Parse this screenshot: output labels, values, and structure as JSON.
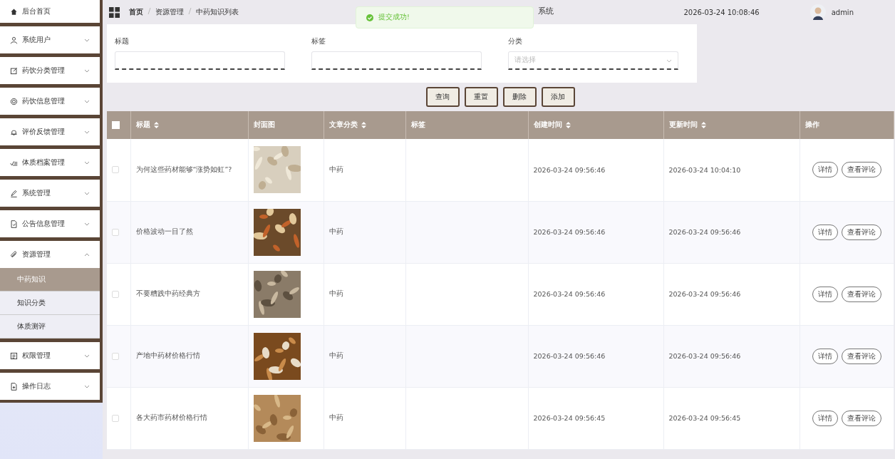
{
  "sidebar": {
    "items": [
      {
        "label": "后台首页",
        "kind": "link"
      },
      {
        "label": "系统用户",
        "kind": "group",
        "expanded": false
      },
      {
        "label": "药饮分类管理",
        "kind": "group",
        "expanded": false
      },
      {
        "label": "药饮信息管理",
        "kind": "group",
        "expanded": false
      },
      {
        "label": "评价反馈管理",
        "kind": "group",
        "expanded": false
      },
      {
        "label": "体质档案管理",
        "kind": "group",
        "expanded": false
      },
      {
        "label": "系统管理",
        "kind": "group",
        "expanded": false
      },
      {
        "label": "公告信息管理",
        "kind": "group",
        "expanded": false
      },
      {
        "label": "资源管理",
        "kind": "group",
        "expanded": true,
        "children": [
          {
            "label": "中药知识",
            "selected": true
          },
          {
            "label": "知识分类",
            "selected": false
          },
          {
            "label": "体质测评",
            "selected": false
          }
        ]
      },
      {
        "label": "权限管理",
        "kind": "group",
        "expanded": false
      },
      {
        "label": "操作日志",
        "kind": "group",
        "expanded": false
      }
    ]
  },
  "header": {
    "breadcrumb": [
      "首页",
      "资源管理",
      "中药知识列表"
    ],
    "title": "系统",
    "datetime": "2026-03-24 10:08:46",
    "user": "admin"
  },
  "toast": {
    "message": "提交成功!"
  },
  "filters": [
    {
      "label": "标题",
      "kind": "text"
    },
    {
      "label": "标签",
      "kind": "text"
    },
    {
      "label": "分类",
      "kind": "select",
      "placeholder": "请选择"
    }
  ],
  "buttons": [
    "查询",
    "重置",
    "删除",
    "添加"
  ],
  "table": {
    "select_all": {
      "checked": false
    },
    "columns": [
      {
        "label": "标题",
        "sortable": true
      },
      {
        "label": "封面图",
        "sortable": false
      },
      {
        "label": "文章分类",
        "sortable": true
      },
      {
        "label": "标签",
        "sortable": false
      },
      {
        "label": "创建时间",
        "sortable": true
      },
      {
        "label": "更新时间",
        "sortable": true
      },
      {
        "label": "操作",
        "sortable": false
      }
    ],
    "rows": [
      {
        "checked": false,
        "title": "为何这些药材能够“涨势如虹”?",
        "cover": {
          "kind": "picture"
        },
        "category": "中药",
        "created": "2026-03-24 09:56:46",
        "updated": "2026-03-24 10:04:10",
        "actions": [
          "详情",
          "查看评论"
        ]
      },
      {
        "checked": false,
        "title": "价格波动一目了然",
        "cover": {
          "kind": "picture"
        },
        "category": "中药",
        "created": "2026-03-24 09:56:46",
        "updated": "2026-03-24 09:56:46",
        "actions": [
          "详情",
          "查看评论"
        ]
      },
      {
        "checked": false,
        "title": "不要糟践中药经典方",
        "cover": {
          "kind": "picture"
        },
        "category": "中药",
        "created": "2026-03-24 09:56:46",
        "updated": "2026-03-24 09:56:46",
        "actions": [
          "详情",
          "查看评论"
        ]
      },
      {
        "checked": false,
        "title": "产地中药材价格行情",
        "cover": {
          "kind": "picture"
        },
        "category": "中药",
        "created": "2026-03-24 09:56:46",
        "updated": "2026-03-24 09:56:46",
        "actions": [
          "详情",
          "查看评论"
        ]
      },
      {
        "checked": false,
        "title": "各大药市药材价格行情",
        "cover": {
          "kind": "picture"
        },
        "category": "中药",
        "created": "2026-03-24 09:56:45",
        "updated": "2026-03-24 09:56:45",
        "actions": [
          "详情",
          "查看评论"
        ]
      }
    ]
  }
}
